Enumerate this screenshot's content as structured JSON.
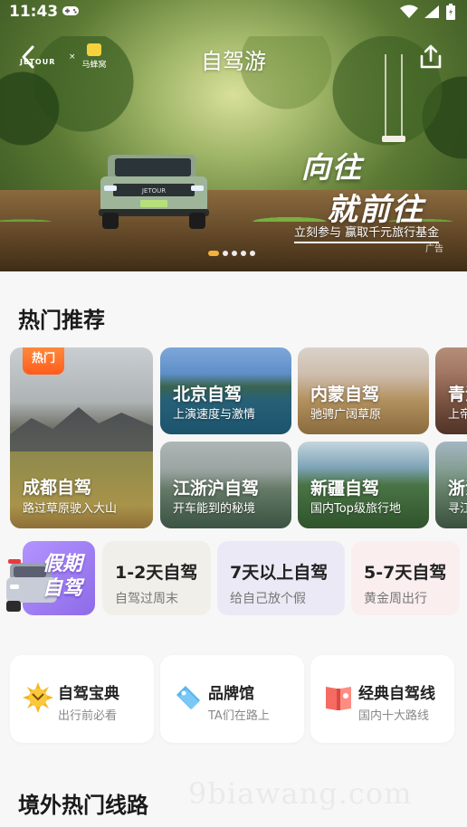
{
  "status_bar": {
    "time": "11:43"
  },
  "header": {
    "title": "自驾游",
    "brand_logo": "JETOUR",
    "partner_separator": "×",
    "partner_logo": "马蜂窝"
  },
  "banner": {
    "slogan_line1": "向往",
    "slogan_line2": "就前往",
    "subtitle": "立刻参与  赢取千元旅行基金",
    "ad_label": "广告",
    "pages": 5,
    "active_page": 1
  },
  "hot_section": {
    "title": "热门推荐",
    "featured": {
      "badge": "热门",
      "title": "成都自驾",
      "subtitle": "路过草原驶入大山"
    },
    "top_row": [
      {
        "title": "北京自驾",
        "subtitle": "上演速度与激情"
      },
      {
        "title": "内蒙自驾",
        "subtitle": "驰骋广阔草原"
      },
      {
        "title": "青海自驾",
        "subtitle": "上帝的调色盘"
      }
    ],
    "bottom_row": [
      {
        "title": "江浙沪自驾",
        "subtitle": "开车能到的秘境"
      },
      {
        "title": "新疆自驾",
        "subtitle": "国内Top级旅行地"
      },
      {
        "title": "浙江自驾",
        "subtitle": "寻江南烟雨"
      }
    ]
  },
  "holiday": {
    "label_line1": "假期",
    "label_line2": "自驾",
    "durations": [
      {
        "title": "1-2天自驾",
        "subtitle": "自驾过周末"
      },
      {
        "title": "7天以上自驾",
        "subtitle": "给自己放个假"
      },
      {
        "title": "5-7天自驾",
        "subtitle": "黄金周出行"
      }
    ]
  },
  "tools": [
    {
      "title": "自驾宝典",
      "subtitle": "出行前必看",
      "icon": "sun-book-icon"
    },
    {
      "title": "品牌馆",
      "subtitle": "TA们在路上",
      "icon": "tag-icon"
    },
    {
      "title": "经典自驾线",
      "subtitle": "国内十大路线",
      "icon": "route-book-icon"
    }
  ],
  "overseas_section": {
    "title": "境外热门线路"
  },
  "watermark": "9biawang.com",
  "colors": {
    "accent": "#f5b23a",
    "hot_badge": "#ff6a26",
    "holiday_purple": "#9a7af0"
  }
}
